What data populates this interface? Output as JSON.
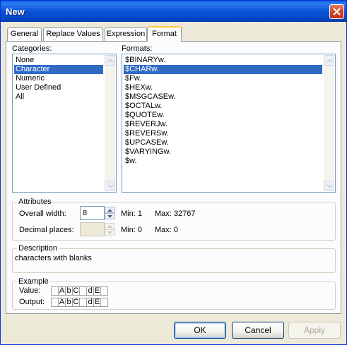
{
  "window": {
    "title": "New"
  },
  "tabs": [
    "General",
    "Replace Values",
    "Expression",
    "Format"
  ],
  "categories": {
    "label": "Categories:",
    "items": [
      "None",
      "Character",
      "Numeric",
      "User Defined",
      "All"
    ],
    "selected": "Character"
  },
  "formats": {
    "label": "Formats:",
    "items": [
      "$BINARYw.",
      "$CHARw.",
      "$Fw.",
      "$HEXw.",
      "$MSGCASEw.",
      "$OCTALw.",
      "$QUOTEw.",
      "$REVERJw.",
      "$REVERSw.",
      "$UPCASEw.",
      "$VARYINGw.",
      "$w."
    ],
    "selected": "$CHARw."
  },
  "attributes": {
    "title": "Attributes",
    "overall_width_label": "Overall width:",
    "overall_width_value": "8",
    "overall_min": "Min:  1",
    "overall_max": "Max:  32767",
    "decimal_label": "Decimal places:",
    "decimal_value": "",
    "decimal_min": "Min:  0",
    "decimal_max": "Max:  0"
  },
  "description": {
    "title": "Description",
    "text": "characters with blanks"
  },
  "example": {
    "title": "Example",
    "value_label": "Value:",
    "output_label": "Output:",
    "value_cells": [
      "",
      "A",
      "b",
      "C",
      "",
      "d",
      "E",
      ""
    ],
    "output_cells": [
      "",
      "A",
      "b",
      "C",
      "",
      "d",
      "E",
      ""
    ]
  },
  "buttons": {
    "ok": "OK",
    "cancel": "Cancel",
    "apply": "Apply"
  },
  "icons": {
    "close": "close-icon",
    "scroll_up": "arrow-up-icon",
    "scroll_down": "arrow-down-icon"
  }
}
